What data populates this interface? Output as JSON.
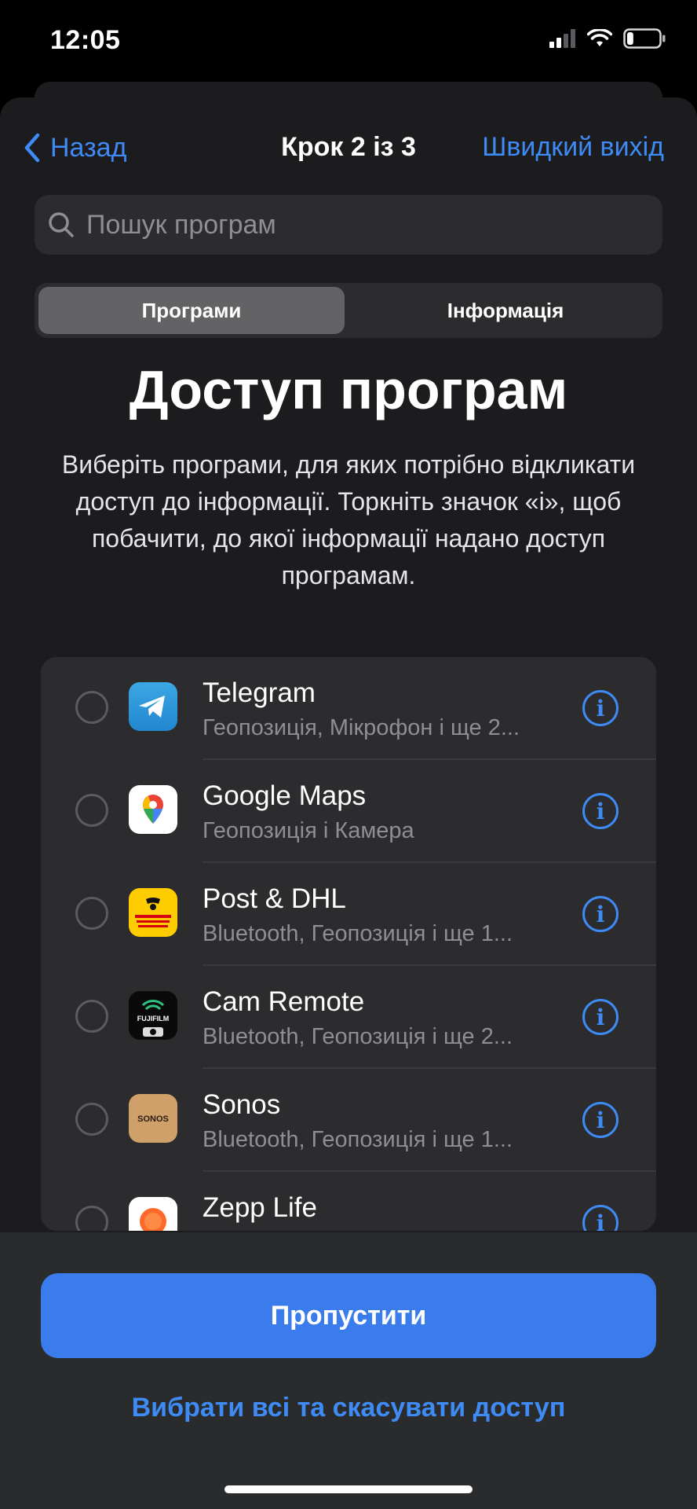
{
  "status_bar": {
    "time": "12:05",
    "battery_level": 0.2
  },
  "nav": {
    "back_label": "Назад",
    "title": "Крок 2 із 3",
    "exit_label": "Швидкий вихід"
  },
  "search": {
    "placeholder": "Пошук програм",
    "value": ""
  },
  "segments": {
    "active": "Програми",
    "inactive": "Інформація"
  },
  "headline": "Доступ програм",
  "description": "Виберіть програми, для яких потрібно відкликати доступ до інформації. Торкніть значок «і», щоб побачити, до якої інформації надано доступ програмам.",
  "apps": [
    {
      "name": "Telegram",
      "permissions": "Геопозиція, Мікрофон і ще 2...",
      "icon": "telegram-icon"
    },
    {
      "name": "Google Maps",
      "permissions": "Геопозиція і Камера",
      "icon": "google-maps-icon"
    },
    {
      "name": "Post & DHL",
      "permissions": "Bluetooth, Геопозиція і ще 1...",
      "icon": "dhl-icon"
    },
    {
      "name": "Cam Remote",
      "permissions": "Bluetooth, Геопозиція і ще 2...",
      "icon": "fujifilm-icon",
      "icon_text": "FUJIFILM"
    },
    {
      "name": "Sonos",
      "permissions": "Bluetooth, Геопозиція і ще 1...",
      "icon": "sonos-icon",
      "icon_text": "SONOS"
    },
    {
      "name": "Zepp Life",
      "permissions": "",
      "icon": "zepp-icon"
    }
  ],
  "actions": {
    "skip": "Пропустити",
    "select_all": "Вибрати всі та скасувати доступ"
  },
  "colors": {
    "accent": "#3e8bf5",
    "button": "#3a7cec",
    "sheet": "#1c1c1e",
    "list": "#2c2c2e"
  }
}
